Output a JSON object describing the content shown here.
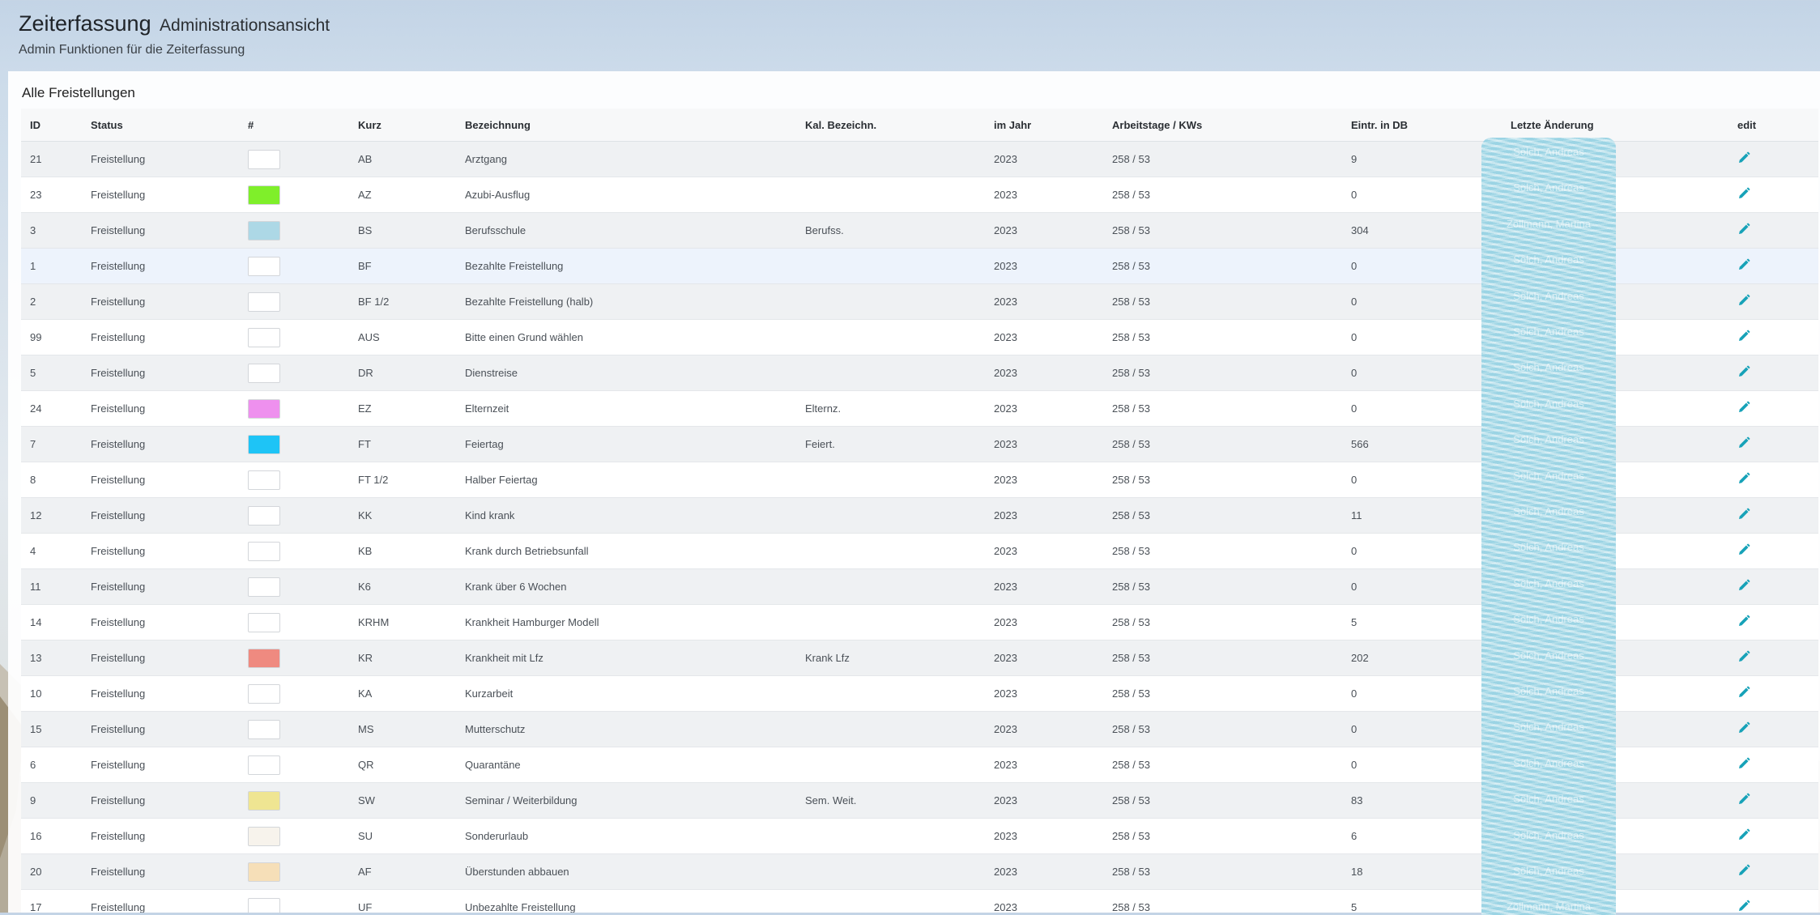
{
  "header": {
    "title": "Zeiterfassung",
    "title_suffix": "Administrationsansicht",
    "subtitle": "Admin Funktionen für die Zeiterfassung"
  },
  "card": {
    "title": "Alle Freistellungen"
  },
  "table": {
    "columns": [
      "ID",
      "Status",
      "#",
      "Kurz",
      "Bezeichnung",
      "Kal. Bezeichn.",
      "im Jahr",
      "Arbeitstage / KWs",
      "Eintr. in DB",
      "Letzte Änderung",
      "edit"
    ],
    "rows": [
      {
        "id": "21",
        "status": "Freistellung",
        "color": "#ffffff",
        "kurz": "AB",
        "bezeichnung": "Arztgang",
        "kal": "",
        "jahr": "2023",
        "tage": "258 / 53",
        "eintr": "9",
        "changed": "Sölch, Andreas"
      },
      {
        "id": "23",
        "status": "Freistellung",
        "color": "#7fef2a",
        "kurz": "AZ",
        "bezeichnung": "Azubi-Ausflug",
        "kal": "",
        "jahr": "2023",
        "tage": "258 / 53",
        "eintr": "0",
        "changed": "Sölch, Andreas"
      },
      {
        "id": "3",
        "status": "Freistellung",
        "color": "#add8e6",
        "kurz": "BS",
        "bezeichnung": "Berufsschule",
        "kal": "Berufss.",
        "jahr": "2023",
        "tage": "258 / 53",
        "eintr": "304",
        "changed": "Zöllmann, Martina"
      },
      {
        "id": "1",
        "status": "Freistellung",
        "color": "#ffffff",
        "kurz": "BF",
        "bezeichnung": "Bezahlte Freistellung",
        "kal": "",
        "jahr": "2023",
        "tage": "258 / 53",
        "eintr": "0",
        "changed": "Sölch, Andreas"
      },
      {
        "id": "2",
        "status": "Freistellung",
        "color": "#ffffff",
        "kurz": "BF 1/2",
        "bezeichnung": "Bezahlte Freistellung (halb)",
        "kal": "",
        "jahr": "2023",
        "tage": "258 / 53",
        "eintr": "0",
        "changed": "Sölch, Andreas"
      },
      {
        "id": "99",
        "status": "Freistellung",
        "color": "#ffffff",
        "kurz": "AUS",
        "bezeichnung": "Bitte einen Grund wählen",
        "kal": "",
        "jahr": "2023",
        "tage": "258 / 53",
        "eintr": "0",
        "changed": "Sölch, Andreas"
      },
      {
        "id": "5",
        "status": "Freistellung",
        "color": "#ffffff",
        "kurz": "DR",
        "bezeichnung": "Dienstreise",
        "kal": "",
        "jahr": "2023",
        "tage": "258 / 53",
        "eintr": "0",
        "changed": "Sölch, Andreas"
      },
      {
        "id": "24",
        "status": "Freistellung",
        "color": "#ee90ee",
        "kurz": "EZ",
        "bezeichnung": "Elternzeit",
        "kal": "Elternz.",
        "jahr": "2023",
        "tage": "258 / 53",
        "eintr": "0",
        "changed": "Sölch, Andreas"
      },
      {
        "id": "7",
        "status": "Freistellung",
        "color": "#1ec4f6",
        "kurz": "FT",
        "bezeichnung": "Feiertag",
        "kal": "Feiert.",
        "jahr": "2023",
        "tage": "258 / 53",
        "eintr": "566",
        "changed": "Sölch, Andreas"
      },
      {
        "id": "8",
        "status": "Freistellung",
        "color": "#ffffff",
        "kurz": "FT 1/2",
        "bezeichnung": "Halber Feiertag",
        "kal": "",
        "jahr": "2023",
        "tage": "258 / 53",
        "eintr": "0",
        "changed": "Sölch, Andreas"
      },
      {
        "id": "12",
        "status": "Freistellung",
        "color": "#ffffff",
        "kurz": "KK",
        "bezeichnung": "Kind krank",
        "kal": "",
        "jahr": "2023",
        "tage": "258 / 53",
        "eintr": "11",
        "changed": "Sölch, Andreas"
      },
      {
        "id": "4",
        "status": "Freistellung",
        "color": "#ffffff",
        "kurz": "KB",
        "bezeichnung": "Krank durch Betriebsunfall",
        "kal": "",
        "jahr": "2023",
        "tage": "258 / 53",
        "eintr": "0",
        "changed": "Sölch, Andreas"
      },
      {
        "id": "11",
        "status": "Freistellung",
        "color": "#ffffff",
        "kurz": "K6",
        "bezeichnung": "Krank über 6 Wochen",
        "kal": "",
        "jahr": "2023",
        "tage": "258 / 53",
        "eintr": "0",
        "changed": "Sölch, Andreas"
      },
      {
        "id": "14",
        "status": "Freistellung",
        "color": "#ffffff",
        "kurz": "KRHM",
        "bezeichnung": "Krankheit Hamburger Modell",
        "kal": "",
        "jahr": "2023",
        "tage": "258 / 53",
        "eintr": "5",
        "changed": "Sölch, Andreas"
      },
      {
        "id": "13",
        "status": "Freistellung",
        "color": "#ef8a80",
        "kurz": "KR",
        "bezeichnung": "Krankheit mit Lfz",
        "kal": "Krank Lfz",
        "jahr": "2023",
        "tage": "258 / 53",
        "eintr": "202",
        "changed": "Sölch, Andreas"
      },
      {
        "id": "10",
        "status": "Freistellung",
        "color": "#ffffff",
        "kurz": "KA",
        "bezeichnung": "Kurzarbeit",
        "kal": "",
        "jahr": "2023",
        "tage": "258 / 53",
        "eintr": "0",
        "changed": "Sölch, Andreas"
      },
      {
        "id": "15",
        "status": "Freistellung",
        "color": "#ffffff",
        "kurz": "MS",
        "bezeichnung": "Mutterschutz",
        "kal": "",
        "jahr": "2023",
        "tage": "258 / 53",
        "eintr": "0",
        "changed": "Sölch, Andreas"
      },
      {
        "id": "6",
        "status": "Freistellung",
        "color": "#ffffff",
        "kurz": "QR",
        "bezeichnung": "Quarantäne",
        "kal": "",
        "jahr": "2023",
        "tage": "258 / 53",
        "eintr": "0",
        "changed": "Sölch, Andreas"
      },
      {
        "id": "9",
        "status": "Freistellung",
        "color": "#efe592",
        "kurz": "SW",
        "bezeichnung": "Seminar / Weiterbildung",
        "kal": "Sem. Weit.",
        "jahr": "2023",
        "tage": "258 / 53",
        "eintr": "83",
        "changed": "Sölch, Andreas"
      },
      {
        "id": "16",
        "status": "Freistellung",
        "color": "#f7f3ec",
        "kurz": "SU",
        "bezeichnung": "Sonderurlaub",
        "kal": "",
        "jahr": "2023",
        "tage": "258 / 53",
        "eintr": "6",
        "changed": "Sölch, Andreas"
      },
      {
        "id": "20",
        "status": "Freistellung",
        "color": "#f6dfb8",
        "kurz": "AF",
        "bezeichnung": "Überstunden abbauen",
        "kal": "",
        "jahr": "2023",
        "tage": "258 / 53",
        "eintr": "18",
        "changed": "Sölch, Andreas"
      },
      {
        "id": "17",
        "status": "Freistellung",
        "color": "#ffffff",
        "kurz": "UF",
        "bezeichnung": "Unbezahlte Freistellung",
        "kal": "",
        "jahr": "2023",
        "tage": "258 / 53",
        "eintr": "5",
        "changed": "Zöllmann, Martina"
      }
    ]
  },
  "colors": {
    "edit_icon": "#17a2b8",
    "redaction": "#aedbe8"
  },
  "icons": {
    "edit": "pencil-icon"
  }
}
